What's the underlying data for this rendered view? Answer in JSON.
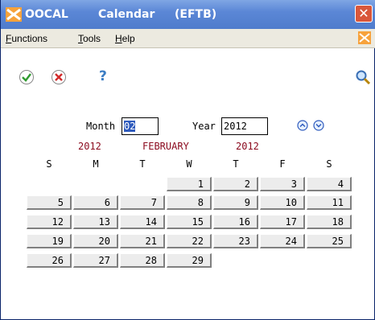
{
  "title": {
    "app_code": "OOCAL",
    "app_name": "Calendar",
    "app_suffix": "(EFTB)"
  },
  "menu": [
    {
      "label": "Functions",
      "mnemonic": "F",
      "rest": "unctions"
    },
    {
      "label": "Tools",
      "mnemonic": "T",
      "rest": "ools"
    },
    {
      "label": "Help",
      "mnemonic": "H",
      "rest": "elp"
    }
  ],
  "toolbar": {
    "help_label": "?"
  },
  "form": {
    "month_label": "Month",
    "month_value": "02",
    "year_label": "Year",
    "year_value": "2012"
  },
  "calendar": {
    "header_left_year": "2012",
    "header_month": "FEBRUARY",
    "header_right_year": "2012",
    "weekdays": [
      "S",
      "M",
      "T",
      "W",
      "T",
      "F",
      "S"
    ],
    "weeks": [
      [
        "",
        "",
        "",
        "1",
        "2",
        "3",
        "4"
      ],
      [
        "5",
        "6",
        "7",
        "8",
        "9",
        "10",
        "11"
      ],
      [
        "12",
        "13",
        "14",
        "15",
        "16",
        "17",
        "18"
      ],
      [
        "19",
        "20",
        "21",
        "22",
        "23",
        "24",
        "25"
      ],
      [
        "26",
        "27",
        "28",
        "29",
        "",
        "",
        ""
      ]
    ]
  },
  "colors": {
    "title_bar": "#5b87d6",
    "menu_bar": "#eceae0",
    "header_red": "#8b0a1e",
    "selection": "#2f5bbd"
  }
}
